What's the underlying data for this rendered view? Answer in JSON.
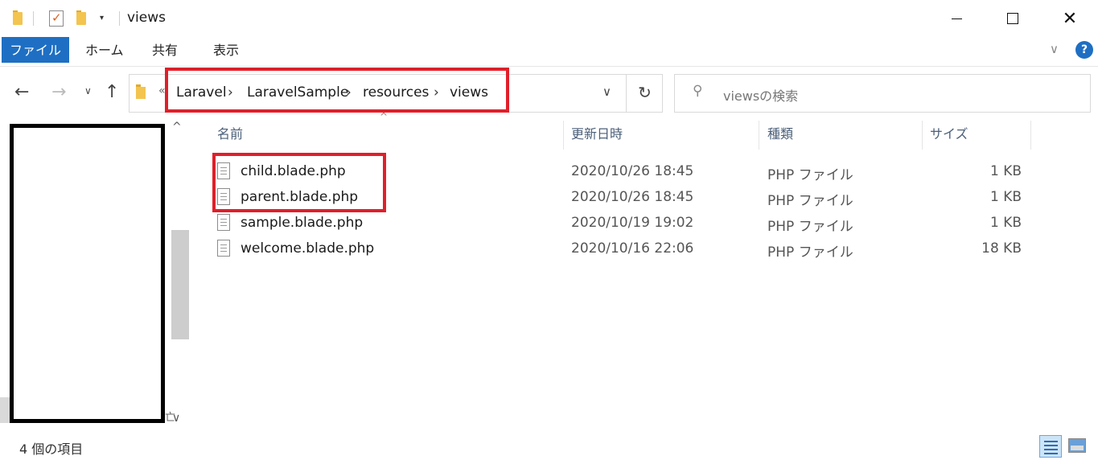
{
  "window": {
    "title": "views",
    "minimize_glyph": "",
    "close_glyph": "✕"
  },
  "quick_access": {
    "dropdown_glyph": "▾"
  },
  "ribbon": {
    "tabs": [
      {
        "label": "ファイル",
        "active": true
      },
      {
        "label": "ホーム"
      },
      {
        "label": "共有"
      },
      {
        "label": "表示"
      }
    ],
    "expand_glyph": "∨",
    "help_glyph": "?"
  },
  "nav": {
    "back_glyph": "←",
    "forward_glyph": "→",
    "recent_glyph": "∨",
    "up_glyph": "↑"
  },
  "address": {
    "overflow_glyph": "«",
    "breadcrumbs": [
      "Laravel",
      "LaravelSample",
      "resources",
      "views"
    ],
    "separator": "›",
    "dropdown_glyph": "∨",
    "refresh_glyph": "↻"
  },
  "search": {
    "placeholder": "viewsの検索",
    "icon": "search-icon"
  },
  "columns": {
    "name": "名前",
    "date": "更新日時",
    "type": "種類",
    "size": "サイズ",
    "sort_glyph": "^"
  },
  "files": [
    {
      "name": "child.blade.php",
      "date": "2020/10/26 18:45",
      "type": "PHP ファイル",
      "size": "1 KB"
    },
    {
      "name": "parent.blade.php",
      "date": "2020/10/26 18:45",
      "type": "PHP ファイル",
      "size": "1 KB"
    },
    {
      "name": "sample.blade.php",
      "date": "2020/10/19 19:02",
      "type": "PHP ファイル",
      "size": "1 KB"
    },
    {
      "name": "welcome.blade.php",
      "date": "2020/10/16 22:06",
      "type": "PHP ファイル",
      "size": "18 KB"
    }
  ],
  "left_pane": {
    "scroll_up_glyph": "^",
    "scroll_down_glyph": "∨",
    "stub_glyph": "亡"
  },
  "status": {
    "item_count": "4 個の項目"
  },
  "colors": {
    "accent": "#1e6fc3",
    "highlight": "#e01f2a",
    "folder": "#f3c44e"
  }
}
